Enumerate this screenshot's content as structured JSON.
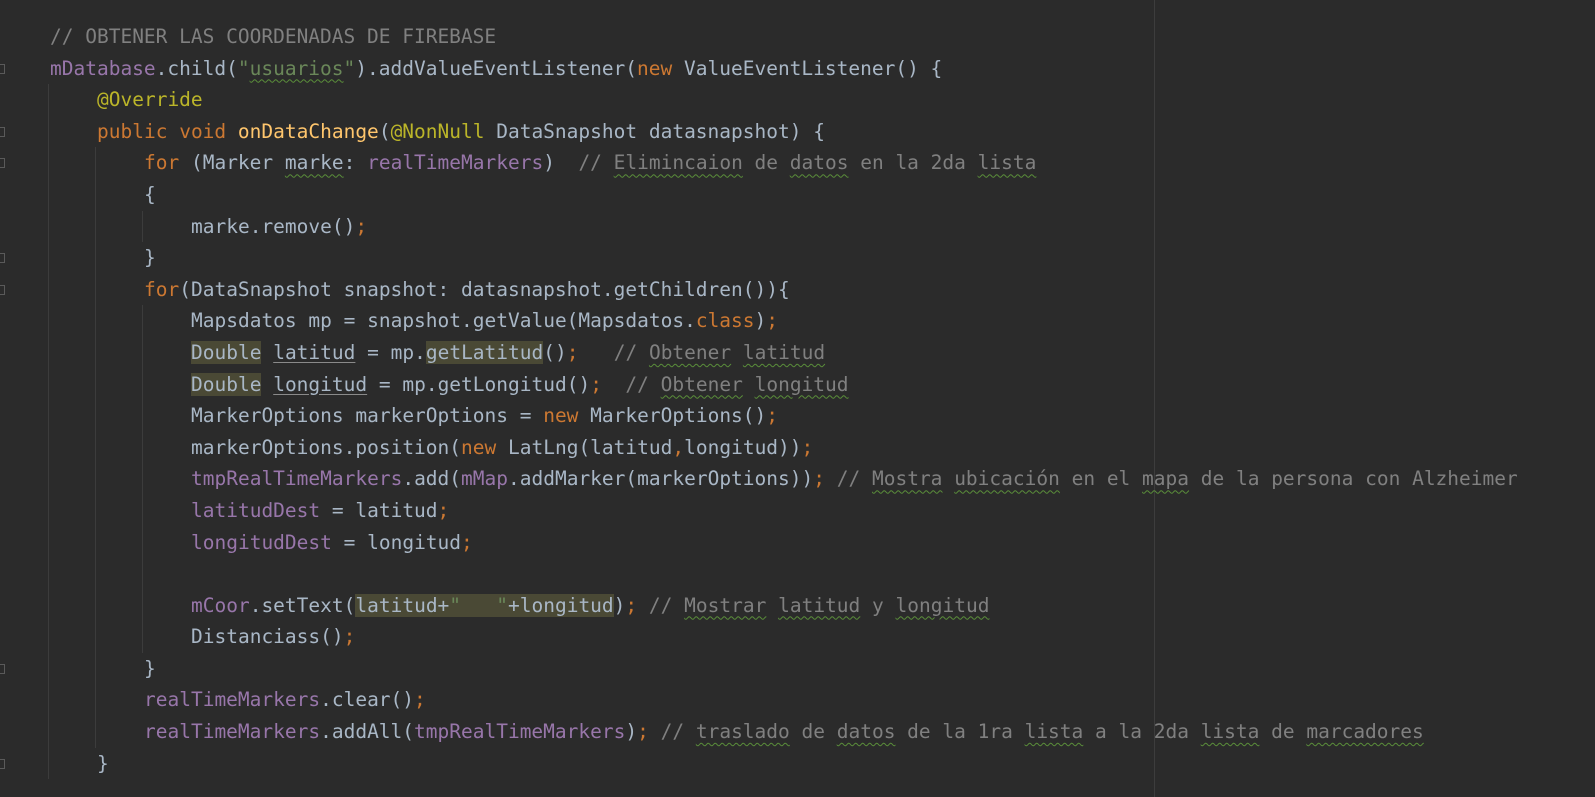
{
  "editor": {
    "language": "java",
    "colors": {
      "background": "#2b2b2b",
      "default": "#a9b7c6",
      "comment": "#808080",
      "keyword": "#cc7832",
      "string": "#6a8759",
      "annotation": "#bbb529",
      "field": "#9876aa",
      "method_declaration": "#ffc66d",
      "highlight": "#4a4935"
    },
    "lines": [
      {
        "indent": 0,
        "fold": false,
        "tokens": [
          {
            "text": "// ",
            "type": "cmt"
          },
          {
            "text": "OBTENER",
            "type": "cmt",
            "u": true
          },
          {
            "text": " LAS ",
            "type": "cmt"
          },
          {
            "text": "COORDENADAS",
            "type": "cmt",
            "u": true
          },
          {
            "text": " DE FIREBASE",
            "type": "cmt"
          }
        ]
      },
      {
        "indent": 0,
        "fold": true,
        "tokens": [
          {
            "text": "mDatabase",
            "type": "fld"
          },
          {
            "text": ".child(",
            "type": "def"
          },
          {
            "text": "\"",
            "type": "str"
          },
          {
            "text": "usuarios",
            "type": "str",
            "sp": true
          },
          {
            "text": "\"",
            "type": "str"
          },
          {
            "text": ").addValueEventListener(",
            "type": "def"
          },
          {
            "text": "new",
            "type": "kw"
          },
          {
            "text": " ValueEventListener() {",
            "type": "def"
          }
        ]
      },
      {
        "indent": 1,
        "fold": false,
        "tokens": [
          {
            "text": "@Override",
            "type": "ann"
          }
        ]
      },
      {
        "indent": 1,
        "fold": true,
        "tokens": [
          {
            "text": "public",
            "type": "kw"
          },
          {
            "text": " ",
            "type": "def"
          },
          {
            "text": "void",
            "type": "kw"
          },
          {
            "text": " ",
            "type": "def"
          },
          {
            "text": "onDataChange",
            "type": "mth"
          },
          {
            "text": "(",
            "type": "def"
          },
          {
            "text": "@NonNull",
            "type": "ann"
          },
          {
            "text": " DataSnapshot datasnapshot) {",
            "type": "def"
          }
        ]
      },
      {
        "indent": 2,
        "fold": true,
        "tokens": [
          {
            "text": "for",
            "type": "kw"
          },
          {
            "text": " (Marker ",
            "type": "def"
          },
          {
            "text": "marke",
            "type": "def",
            "sp": true
          },
          {
            "text": ": ",
            "type": "def"
          },
          {
            "text": "realTimeMarkers",
            "type": "fld"
          },
          {
            "text": ")  ",
            "type": "def"
          },
          {
            "text": "// ",
            "type": "cmt"
          },
          {
            "text": "Elimincaion",
            "type": "cmt",
            "sp": true
          },
          {
            "text": " de ",
            "type": "cmt"
          },
          {
            "text": "datos",
            "type": "cmt",
            "sp": true
          },
          {
            "text": " en la 2da ",
            "type": "cmt"
          },
          {
            "text": "lista",
            "type": "cmt",
            "sp": true
          }
        ]
      },
      {
        "indent": 2,
        "fold": false,
        "tokens": [
          {
            "text": "{",
            "type": "def"
          }
        ]
      },
      {
        "indent": 3,
        "fold": false,
        "tokens": [
          {
            "text": "marke.remove()",
            "type": "def"
          },
          {
            "text": ";",
            "type": "pun"
          }
        ]
      },
      {
        "indent": 2,
        "fold": true,
        "tokens": [
          {
            "text": "}",
            "type": "def"
          }
        ]
      },
      {
        "indent": 2,
        "fold": true,
        "tokens": [
          {
            "text": "for",
            "type": "kw"
          },
          {
            "text": "(DataSnapshot snapshot: datasnapshot.getChildren()){",
            "type": "def"
          }
        ]
      },
      {
        "indent": 3,
        "fold": false,
        "tokens": [
          {
            "text": "Mapsdatos mp = snapshot.getValue(Mapsdatos.",
            "type": "def"
          },
          {
            "text": "class",
            "type": "kw"
          },
          {
            "text": ")",
            "type": "def"
          },
          {
            "text": ";",
            "type": "pun"
          }
        ]
      },
      {
        "indent": 3,
        "fold": false,
        "tokens": [
          {
            "text": "Double",
            "type": "def",
            "hl": true
          },
          {
            "text": " ",
            "type": "def"
          },
          {
            "text": "latitud",
            "type": "def",
            "ul": true
          },
          {
            "text": " = mp.",
            "type": "def"
          },
          {
            "text": "getLatitud",
            "type": "def",
            "hl": true
          },
          {
            "text": "()",
            "type": "def"
          },
          {
            "text": ";",
            "type": "pun"
          },
          {
            "text": "   ",
            "type": "def"
          },
          {
            "text": "// ",
            "type": "cmt"
          },
          {
            "text": "Obtener",
            "type": "cmt",
            "sp": true
          },
          {
            "text": " ",
            "type": "cmt"
          },
          {
            "text": "latitud",
            "type": "cmt",
            "sp": true
          }
        ]
      },
      {
        "indent": 3,
        "fold": false,
        "tokens": [
          {
            "text": "Double",
            "type": "def",
            "hl": true
          },
          {
            "text": " ",
            "type": "def"
          },
          {
            "text": "longitud",
            "type": "def",
            "ul": true
          },
          {
            "text": " = mp.getLongitud()",
            "type": "def"
          },
          {
            "text": ";",
            "type": "pun"
          },
          {
            "text": "  ",
            "type": "def"
          },
          {
            "text": "// ",
            "type": "cmt"
          },
          {
            "text": "Obtener",
            "type": "cmt",
            "sp": true
          },
          {
            "text": " ",
            "type": "cmt"
          },
          {
            "text": "longitud",
            "type": "cmt",
            "sp": true
          }
        ]
      },
      {
        "indent": 3,
        "fold": false,
        "tokens": [
          {
            "text": "MarkerOptions markerOptions = ",
            "type": "def"
          },
          {
            "text": "new",
            "type": "kw"
          },
          {
            "text": " MarkerOptions()",
            "type": "def"
          },
          {
            "text": ";",
            "type": "pun"
          }
        ]
      },
      {
        "indent": 3,
        "fold": false,
        "tokens": [
          {
            "text": "markerOptions.position(",
            "type": "def"
          },
          {
            "text": "new",
            "type": "kw"
          },
          {
            "text": " LatLng(latitud",
            "type": "def"
          },
          {
            "text": ",",
            "type": "pun"
          },
          {
            "text": "longitud))",
            "type": "def"
          },
          {
            "text": ";",
            "type": "pun"
          }
        ]
      },
      {
        "indent": 3,
        "fold": false,
        "tokens": [
          {
            "text": "tmpRealTimeMarkers",
            "type": "fld"
          },
          {
            "text": ".add(",
            "type": "def"
          },
          {
            "text": "mMap",
            "type": "fld"
          },
          {
            "text": ".addMarker(markerOptions))",
            "type": "def"
          },
          {
            "text": ";",
            "type": "pun"
          },
          {
            "text": " ",
            "type": "def"
          },
          {
            "text": "// ",
            "type": "cmt"
          },
          {
            "text": "Mostra",
            "type": "cmt",
            "sp": true
          },
          {
            "text": " ",
            "type": "cmt"
          },
          {
            "text": "ubicación",
            "type": "cmt",
            "sp": true
          },
          {
            "text": " en el ",
            "type": "cmt"
          },
          {
            "text": "mapa",
            "type": "cmt",
            "sp": true
          },
          {
            "text": " de la persona con Alzheimer",
            "type": "cmt"
          }
        ]
      },
      {
        "indent": 3,
        "fold": false,
        "tokens": [
          {
            "text": "latitudDest",
            "type": "fld"
          },
          {
            "text": " = latitud",
            "type": "def"
          },
          {
            "text": ";",
            "type": "pun"
          }
        ]
      },
      {
        "indent": 3,
        "fold": false,
        "tokens": [
          {
            "text": "longitudDest",
            "type": "fld"
          },
          {
            "text": " = longitud",
            "type": "def"
          },
          {
            "text": ";",
            "type": "pun"
          }
        ]
      },
      {
        "indent": 3,
        "fold": false,
        "tokens": []
      },
      {
        "indent": 3,
        "fold": false,
        "tokens": [
          {
            "text": "mCoor",
            "type": "fld"
          },
          {
            "text": ".setText(",
            "type": "def"
          },
          {
            "text": "latitud+",
            "type": "def",
            "hl": true
          },
          {
            "text": "\"   \"",
            "type": "str",
            "hl": true
          },
          {
            "text": "+longitud",
            "type": "def",
            "hl": true
          },
          {
            "text": ")",
            "type": "def"
          },
          {
            "text": ";",
            "type": "pun"
          },
          {
            "text": " ",
            "type": "def"
          },
          {
            "text": "// ",
            "type": "cmt"
          },
          {
            "text": "Mostrar",
            "type": "cmt",
            "sp": true
          },
          {
            "text": " ",
            "type": "cmt"
          },
          {
            "text": "latitud",
            "type": "cmt",
            "sp": true
          },
          {
            "text": " y ",
            "type": "cmt"
          },
          {
            "text": "longitud",
            "type": "cmt",
            "sp": true
          }
        ]
      },
      {
        "indent": 3,
        "fold": false,
        "tokens": [
          {
            "text": "Distanciass()",
            "type": "def"
          },
          {
            "text": ";",
            "type": "pun"
          }
        ]
      },
      {
        "indent": 2,
        "fold": true,
        "tokens": [
          {
            "text": "}",
            "type": "def"
          }
        ]
      },
      {
        "indent": 2,
        "fold": false,
        "tokens": [
          {
            "text": "realTimeMarkers",
            "type": "fld"
          },
          {
            "text": ".clear()",
            "type": "def"
          },
          {
            "text": ";",
            "type": "pun"
          }
        ]
      },
      {
        "indent": 2,
        "fold": false,
        "tokens": [
          {
            "text": "realTimeMarkers",
            "type": "fld"
          },
          {
            "text": ".addAll(",
            "type": "def"
          },
          {
            "text": "tmpRealTimeMarkers",
            "type": "fld"
          },
          {
            "text": ")",
            "type": "def"
          },
          {
            "text": ";",
            "type": "pun"
          },
          {
            "text": " ",
            "type": "def"
          },
          {
            "text": "// ",
            "type": "cmt"
          },
          {
            "text": "traslado",
            "type": "cmt",
            "sp": true
          },
          {
            "text": " de ",
            "type": "cmt"
          },
          {
            "text": "datos",
            "type": "cmt",
            "sp": true
          },
          {
            "text": " de la 1ra ",
            "type": "cmt"
          },
          {
            "text": "lista",
            "type": "cmt",
            "sp": true
          },
          {
            "text": " a la 2da ",
            "type": "cmt"
          },
          {
            "text": "lista",
            "type": "cmt",
            "sp": true
          },
          {
            "text": " de ",
            "type": "cmt"
          },
          {
            "text": "marcadores",
            "type": "cmt",
            "sp": true
          }
        ]
      },
      {
        "indent": 1,
        "fold": true,
        "tokens": [
          {
            "text": "}",
            "type": "def"
          }
        ]
      }
    ]
  }
}
